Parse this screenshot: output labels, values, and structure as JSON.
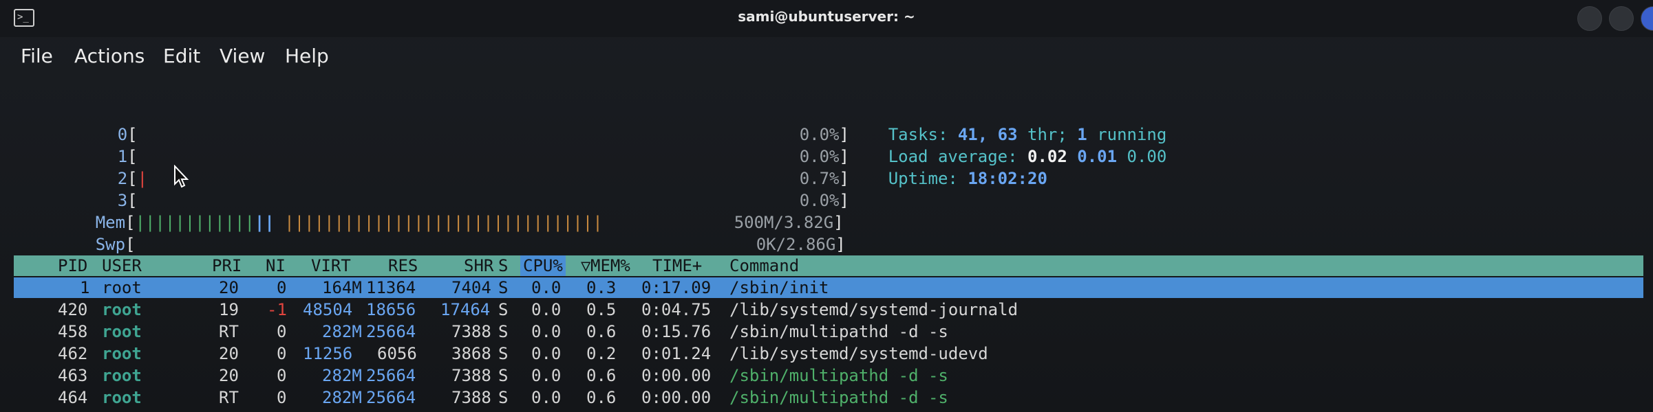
{
  "window": {
    "title": "sami@ubuntuserver: ~"
  },
  "menu": [
    "File",
    "Actions",
    "Edit",
    "View",
    "Help"
  ],
  "meters": {
    "cpu": [
      {
        "label": "0",
        "value": "0.0%"
      },
      {
        "label": "1",
        "value": "0.0%"
      },
      {
        "label": "2",
        "value": "0.7%"
      },
      {
        "label": "3",
        "value": "0.0%"
      }
    ],
    "mem": {
      "label": "Mem",
      "value": "500M/3.82G",
      "fill": 0.13
    },
    "swp": {
      "label": "Swp",
      "value": "0K/2.86G"
    }
  },
  "summary": {
    "tasks_label": "Tasks:",
    "tasks_count": "41,",
    "threads": "63",
    "thr_label": "thr;",
    "running_count": "1",
    "running_label": "running",
    "load_label": "Load average:",
    "load1": "0.02",
    "load5": "0.01",
    "load15": "0.00",
    "uptime_label": "Uptime:",
    "uptime": "18:02:20"
  },
  "table": {
    "columns": [
      "PID",
      "USER",
      "PRI",
      "NI",
      "VIRT",
      "RES",
      "SHR",
      "S",
      "CPU%",
      "MEM%",
      "TIME+",
      "Command"
    ],
    "sort_indicator": "▽",
    "rows": [
      {
        "pid": "1",
        "user": "root",
        "pri": "20",
        "ni": "0",
        "virt": "164M",
        "res": "11364",
        "shr": "7404",
        "s": "S",
        "cpu": "0.0",
        "mem": "0.3",
        "time": "0:17.09",
        "cmd": "/sbin/init"
      },
      {
        "pid": "420",
        "user": "root",
        "pri": "19",
        "ni": "-1",
        "virt": "48504",
        "res": "18656",
        "shr": "17464",
        "s": "S",
        "cpu": "0.0",
        "mem": "0.5",
        "time": "0:04.75",
        "cmd": "/lib/systemd/systemd-journald"
      },
      {
        "pid": "458",
        "user": "root",
        "pri": "RT",
        "ni": "0",
        "virt": "282M",
        "res": "25664",
        "shr": "7388",
        "s": "S",
        "cpu": "0.0",
        "mem": "0.6",
        "time": "0:15.76",
        "cmd": "/sbin/multipathd -d -s"
      },
      {
        "pid": "462",
        "user": "root",
        "pri": "20",
        "ni": "0",
        "virt": "11256",
        "res": "6056",
        "shr": "3868",
        "s": "S",
        "cpu": "0.0",
        "mem": "0.2",
        "time": "0:01.24",
        "cmd": "/lib/systemd/systemd-udevd"
      },
      {
        "pid": "463",
        "user": "root",
        "pri": "20",
        "ni": "0",
        "virt": "282M",
        "res": "25664",
        "shr": "7388",
        "s": "S",
        "cpu": "0.0",
        "mem": "0.6",
        "time": "0:00.00",
        "cmd": "/sbin/multipathd -d -s"
      },
      {
        "pid": "464",
        "user": "root",
        "pri": "RT",
        "ni": "0",
        "virt": "282M",
        "res": "25664",
        "shr": "7388",
        "s": "S",
        "cpu": "0.0",
        "mem": "0.6",
        "time": "0:00.00",
        "cmd": "/sbin/multipathd -d -s"
      }
    ]
  },
  "colors": {
    "header_bg": "#5fa99a",
    "selected_bg": "#4a8ed6",
    "accent_blue": "#6aa6f2"
  },
  "icons": {
    "terminal": "terminal-icon",
    "cursor": "mouse-pointer-icon"
  }
}
